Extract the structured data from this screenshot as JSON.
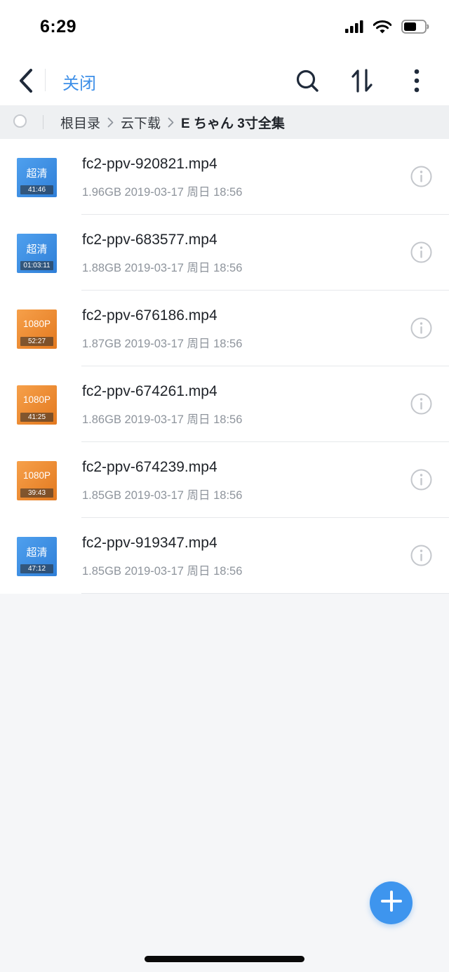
{
  "status_bar": {
    "time": "6:29"
  },
  "nav": {
    "close_label": "关闭"
  },
  "breadcrumb": {
    "items": [
      "根目录",
      "云下载",
      "E ちゃん 3寸全集"
    ]
  },
  "files": [
    {
      "name": "fc2-ppv-920821.mp4",
      "meta": "1.96GB 2019-03-17 周日 18:56",
      "quality": "超清",
      "duration": "41:46",
      "thumb_color": "blue"
    },
    {
      "name": "fc2-ppv-683577.mp4",
      "meta": "1.88GB 2019-03-17 周日 18:56",
      "quality": "超清",
      "duration": "01:03:11",
      "thumb_color": "blue"
    },
    {
      "name": "fc2-ppv-676186.mp4",
      "meta": "1.87GB 2019-03-17 周日 18:56",
      "quality": "1080P",
      "duration": "52:27",
      "thumb_color": "orange"
    },
    {
      "name": "fc2-ppv-674261.mp4",
      "meta": "1.86GB 2019-03-17 周日 18:56",
      "quality": "1080P",
      "duration": "41:25",
      "thumb_color": "orange"
    },
    {
      "name": "fc2-ppv-674239.mp4",
      "meta": "1.85GB 2019-03-17 周日 18:56",
      "quality": "1080P",
      "duration": "39:43",
      "thumb_color": "orange"
    },
    {
      "name": "fc2-ppv-919347.mp4",
      "meta": "1.85GB 2019-03-17 周日 18:56",
      "quality": "超清",
      "duration": "47:12",
      "thumb_color": "blue"
    }
  ],
  "colors": {
    "accent": "#3d8fe8",
    "fab": "#3e95ee",
    "thumb_blue": "#3a8ce4",
    "thumb_orange": "#ec8a33"
  },
  "icons": [
    "signal-icon",
    "wifi-icon",
    "battery-icon",
    "back-arrow-icon",
    "search-icon",
    "sort-icon",
    "more-icon",
    "chevron-right-icon",
    "info-icon",
    "plus-icon"
  ]
}
